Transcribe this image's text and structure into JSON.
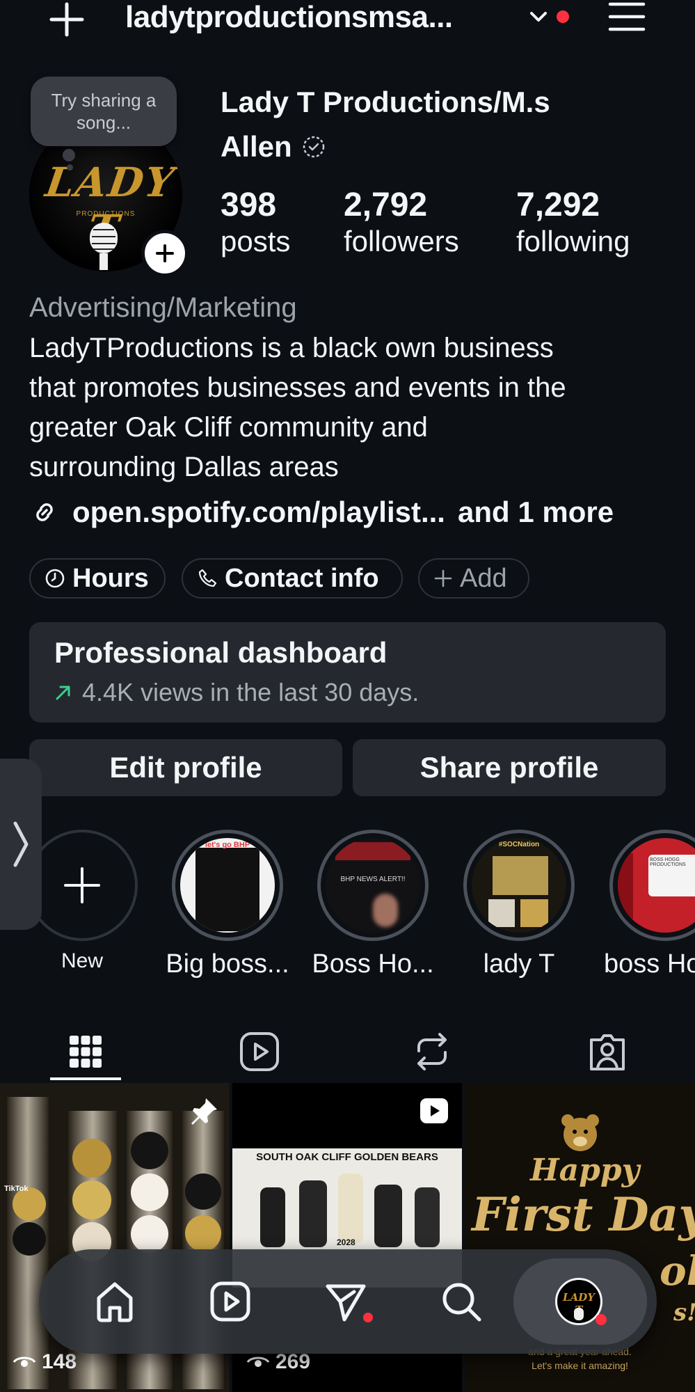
{
  "header": {
    "username": "ladytproductionsmsa...",
    "icons": [
      "plus-icon",
      "chevron-down-icon",
      "notification-dot",
      "menu-icon"
    ]
  },
  "profile": {
    "note": "Try sharing a song...",
    "avatar_text": "LADY T",
    "avatar_subtext": "PRODUCTIONS",
    "display_name_line1": "Lady T Productions/M.s",
    "display_name_line2": "Allen",
    "stats": {
      "posts": {
        "value": "398",
        "label": "posts"
      },
      "followers": {
        "value": "2,792",
        "label": "followers"
      },
      "following": {
        "value": "7,292",
        "label": "following"
      }
    },
    "category": "Advertising/Marketing",
    "bio_lines": [
      "LadyTProductions is a black own business",
      "that promotes businesses and events in the",
      "greater Oak Cliff community and",
      "surrounding Dallas areas"
    ],
    "link": "open.spotify.com/playlist...",
    "link_more": "and 1 more"
  },
  "actions": {
    "hours": "Hours",
    "contact": "Contact info",
    "add": "Add"
  },
  "dashboard": {
    "title": "Professional dashboard",
    "subtitle": "4.4K views in the last 30 days."
  },
  "buttons": {
    "edit": "Edit profile",
    "share": "Share profile"
  },
  "highlights": [
    {
      "label": "New",
      "thumb_text": ""
    },
    {
      "label": "Big boss...",
      "thumb_text": "let's go BHP"
    },
    {
      "label": "Boss Ho...",
      "thumb_text": "BHP NEWS ALERT!!"
    },
    {
      "label": "lady T",
      "thumb_text": "#SOCNation"
    },
    {
      "label": "boss Ho",
      "thumb_text": "BOSS HOGG PRODUCTIONS"
    }
  ],
  "posts": [
    {
      "type": "pinned",
      "views": "148",
      "badge": "TikTok"
    },
    {
      "type": "reel",
      "views": "269",
      "banner": "SOUTH OAK CLIFF GOLDEN BEARS",
      "year": "2028"
    },
    {
      "type": "image",
      "line1": "Happy",
      "line2": "First Day",
      "line3": "ol",
      "line4": "s!",
      "footer1": "and a great year ahead.",
      "footer2": "Let's make it amazing!"
    }
  ],
  "colors": {
    "background": "#0c0f14",
    "surface": "#25292f",
    "muted_text": "#9da3ab",
    "accent_red": "#ff3040",
    "gold": "#c8962c",
    "trend_green": "#3ecf8e"
  }
}
